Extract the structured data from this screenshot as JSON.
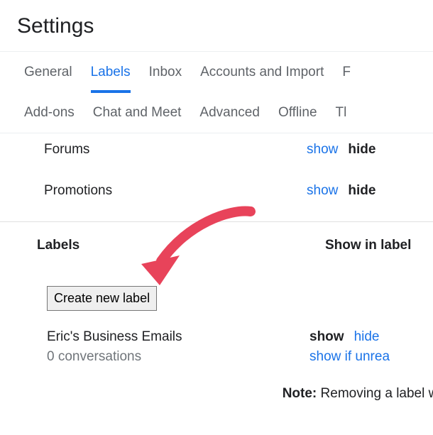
{
  "page": {
    "title": "Settings"
  },
  "tabs": {
    "row1": [
      {
        "label": "General",
        "active": false
      },
      {
        "label": "Labels",
        "active": true
      },
      {
        "label": "Inbox",
        "active": false
      },
      {
        "label": "Accounts and Import",
        "active": false
      },
      {
        "label": "F",
        "active": false
      }
    ],
    "row2": [
      {
        "label": "Add-ons",
        "active": false
      },
      {
        "label": "Chat and Meet",
        "active": false
      },
      {
        "label": "Advanced",
        "active": false
      },
      {
        "label": "Offline",
        "active": false
      },
      {
        "label": "Tl",
        "active": false
      }
    ]
  },
  "categories": [
    {
      "name": "Forums",
      "show_label": "show",
      "hide_label": "hide",
      "current": "hide"
    },
    {
      "name": "Promotions",
      "show_label": "show",
      "hide_label": "hide",
      "current": "hide"
    }
  ],
  "labels_section": {
    "heading": "Labels",
    "column_header": "Show in label",
    "create_button": "Create new label",
    "items": [
      {
        "name": "Eric's Business Emails",
        "sub": "0 conversations",
        "show_label": "show",
        "hide_label": "hide",
        "show_if_unread_label": "show if unrea",
        "current": "show"
      }
    ]
  },
  "note": {
    "prefix": "Note:",
    "text": " Removing a label will"
  },
  "annotation": {
    "color": "#e8435a"
  }
}
